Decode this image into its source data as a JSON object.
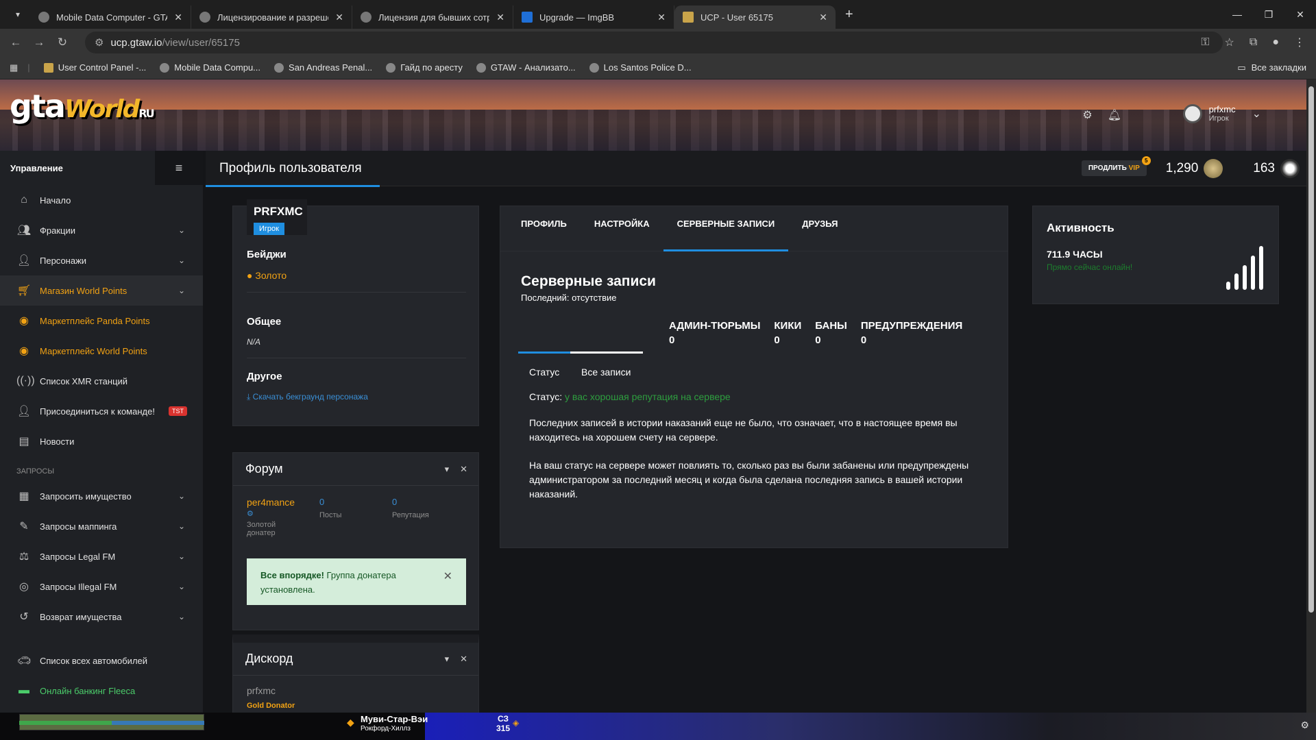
{
  "browser": {
    "tabs": [
      {
        "title": "Mobile Data Computer - GTA W",
        "active": false
      },
      {
        "title": "Лицензирование и разрешен",
        "active": false
      },
      {
        "title": "Лицензия для бывших сотруд",
        "active": false
      },
      {
        "title": "Upgrade — ImgBB",
        "active": false
      },
      {
        "title": "UCP - User 65175",
        "active": true
      }
    ],
    "url_domain": "ucp.gtaw.io",
    "url_path": "/view/user/65175",
    "bookmarks": [
      "User Control Panel -...",
      "Mobile Data Compu...",
      "San Andreas Penal...",
      "Гайд по аресту",
      "GTAW - Анализато...",
      "Los Santos Police D..."
    ],
    "all_bookmarks": "Все закладки"
  },
  "header": {
    "logo_main": "gta",
    "logo_world": "World",
    "logo_ru": "RU",
    "username": "prfxmc",
    "role": "Игрок"
  },
  "sidebar": {
    "title": "Управление",
    "items": [
      {
        "label": "Начало",
        "icon": "home-icon",
        "arrow": false
      },
      {
        "label": "Фракции",
        "icon": "users-icon",
        "arrow": true
      },
      {
        "label": "Персонажи",
        "icon": "user-icon",
        "arrow": true
      },
      {
        "label": "Магазин World Points",
        "icon": "cart-icon",
        "arrow": true
      },
      {
        "label": "Маркетплейс Panda Points",
        "icon": "coins-icon",
        "arrow": false
      },
      {
        "label": "Маркетплейс World Points",
        "icon": "coins-icon",
        "arrow": false
      },
      {
        "label": "Список XMR станций",
        "icon": "antenna-icon",
        "arrow": false
      },
      {
        "label": "Присоединиться к команде!",
        "icon": "user-plus-icon",
        "arrow": false,
        "badge": "TST"
      },
      {
        "label": "Новости",
        "icon": "newspaper-icon",
        "arrow": false
      }
    ],
    "requests_section": "ЗАПРОСЫ",
    "request_items": [
      {
        "label": "Запросить имущество",
        "icon": "building-icon"
      },
      {
        "label": "Запросы маппинга",
        "icon": "brush-icon"
      },
      {
        "label": "Запросы Legal FM",
        "icon": "scale-icon"
      },
      {
        "label": "Запросы Illegal FM",
        "icon": "mask-icon"
      },
      {
        "label": "Возврат имущества",
        "icon": "undo-icon"
      }
    ],
    "bottom_items": [
      {
        "label": "Список всех автомобилей",
        "icon": "car-icon"
      },
      {
        "label": "Онлайн банкинг Fleeca",
        "icon": "bank-card-icon"
      }
    ]
  },
  "topbar": {
    "page_title": "Профиль пользователя",
    "vip_prefix": "ПРОДЛИТЬ",
    "vip_label": "VIP",
    "vip_badge": "5",
    "world_points": "1,290",
    "panda_points": "163"
  },
  "profile": {
    "username": "PRFXMC",
    "role": "Игрок",
    "badges_title": "Бейджи",
    "badge_gold": "Золото",
    "general_title": "Общее",
    "general_value": "N/A",
    "other_title": "Другое",
    "download_link": "Скачать бекграунд персонажа"
  },
  "forum": {
    "title": "Форум",
    "nick": "per4mance",
    "rank_line1": "Золотой",
    "rank_line2": "донатер",
    "posts": "0",
    "posts_label": "Посты",
    "reputation": "0",
    "reputation_label": "Репутация",
    "alert_bold": "Все впорядке!",
    "alert_text": "Группа донатера установлена."
  },
  "discord": {
    "title": "Дискорд",
    "name": "prfxmc",
    "rank": "Gold Donator"
  },
  "records": {
    "tabs": [
      "ПРОФИЛЬ",
      "НАСТРОЙКА",
      "СЕРВЕРНЫЕ ЗАПИСИ",
      "ДРУЗЬЯ"
    ],
    "title": "Серверные записи",
    "last": "Последний: отсутствие",
    "stats": [
      {
        "label": "АДМИН-ТЮРЬМЫ",
        "value": "0"
      },
      {
        "label": "КИКИ",
        "value": "0"
      },
      {
        "label": "БАНЫ",
        "value": "0"
      },
      {
        "label": "ПРЕДУПРЕЖДЕНИЯ",
        "value": "0"
      }
    ],
    "subtab_status": "Статус",
    "subtab_all": "Все записи",
    "status_label": "Статус:",
    "status_value": "у вас хорошая репутация на сервере",
    "para1": "Последних записей в истории наказаний еще не было, что означает, что в настоящее время вы находитесь на хорошем счету на сервере.",
    "para2": "На ваш статус на сервере может повлиять то, сколько раз вы были забанены или предупреждены администратором за последний месяц и когда была сделана последняя запись в вашей истории наказаний."
  },
  "activity": {
    "title": "Активность",
    "hours": "711.9 ЧАСЫ",
    "online": "Прямо сейчас онлайн!"
  },
  "game_hud": {
    "street": "Муви-Стар-Вэи",
    "district": "Рокфорд-Хиллз",
    "direction": "СЗ",
    "heading": "315"
  },
  "colors": {
    "accent": "#1f8ee0",
    "gold": "#f2a213",
    "sidebar_bg": "#1f2125",
    "card_bg": "#24262b",
    "success_bg": "#d4edda"
  }
}
